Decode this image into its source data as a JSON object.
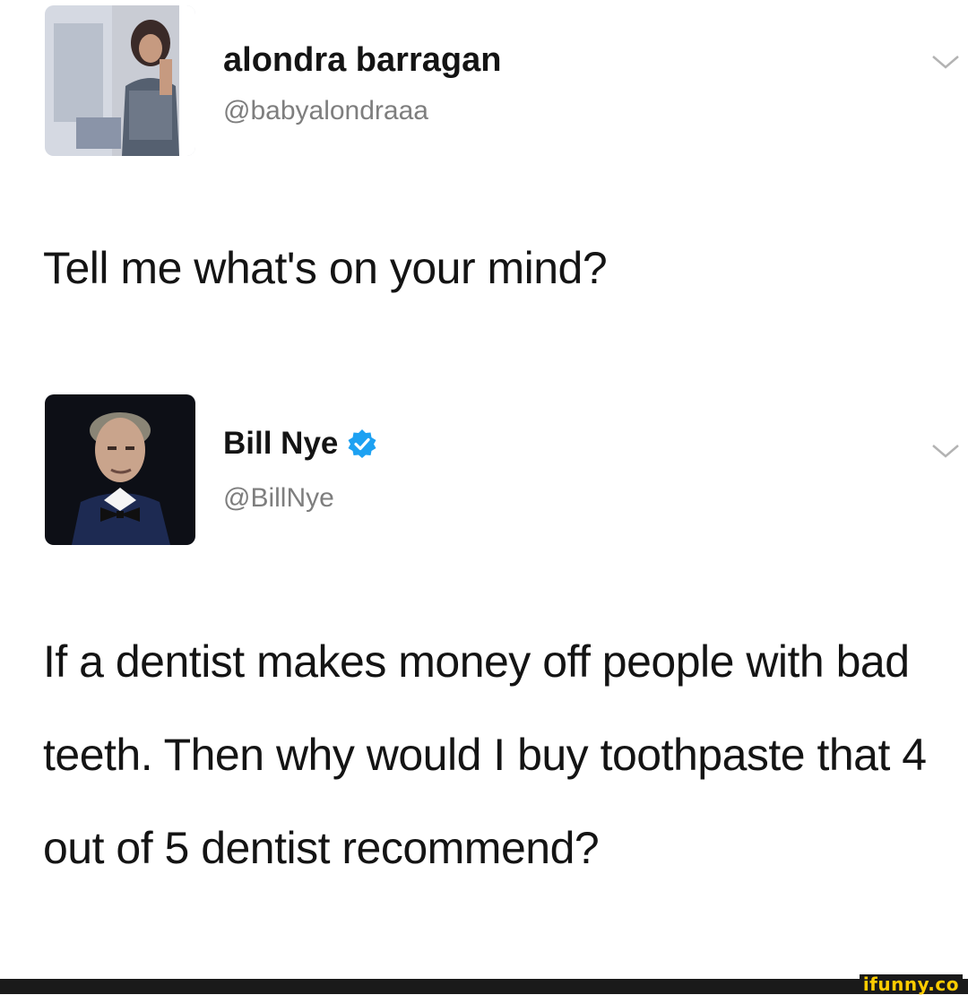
{
  "tweets": [
    {
      "display_name": "alondra barragan",
      "handle": "@babyalondraaa",
      "text": "Tell me what's on your mind?",
      "verified": false,
      "avatar_icon": "user-photo-avatar"
    },
    {
      "display_name": "Bill Nye",
      "handle": "@BillNye",
      "text": "If a dentist makes money off people with bad teeth. Then why would I buy toothpaste that 4 out of 5 dentist recommend?",
      "verified": true,
      "avatar_icon": "user-photo-avatar"
    }
  ],
  "icons": {
    "verified": "verified-badge-icon",
    "menu": "chevron-down-icon"
  },
  "colors": {
    "verified_blue": "#1da1f2",
    "handle_gray": "#7e7e7e",
    "watermark_yellow": "#ffcc00"
  },
  "watermark": {
    "text": "ifunny.co"
  }
}
